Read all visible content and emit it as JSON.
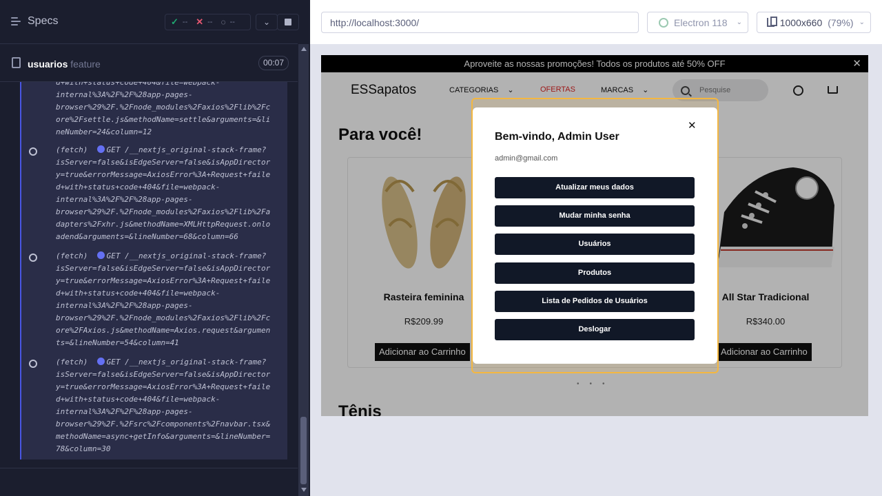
{
  "runner": {
    "specs_label": "Specs",
    "stats": {
      "passed": "--",
      "failed": "--",
      "pending": "--"
    },
    "spec": {
      "name": "usuarios",
      "tag": "feature",
      "time": "00:07"
    },
    "log_entries": [
      {
        "text": "d+with+status+code+404&file=webpack-\ninternal%3A%2F%2F%28app-pages-\nbrowser%29%2F.%2Fnode_modules%2Faxios%2Flib%2Fc\nore%2Fsettle.js&methodName=settle&arguments=&li\nneNumber=24&column=12"
      },
      {
        "prefix": "(fetch)  ",
        "method": "GET",
        "text": " /__nextjs_original-stack-frame?\nisServer=false&isEdgeServer=false&isAppDirector\ny=true&errorMessage=AxiosError%3A+Request+faile\nd+with+status+code+404&file=webpack-\ninternal%3A%2F%2F%28app-pages-\nbrowser%29%2F.%2Fnode_modules%2Faxios%2Flib%2Fa\ndapters%2Fxhr.js&methodName=XMLHttpRequest.onlo\nadend&arguments=&lineNumber=68&column=66"
      },
      {
        "prefix": "(fetch)  ",
        "method": "GET",
        "text": " /__nextjs_original-stack-frame?\nisServer=false&isEdgeServer=false&isAppDirector\ny=true&errorMessage=AxiosError%3A+Request+faile\nd+with+status+code+404&file=webpack-\ninternal%3A%2F%2F%28app-pages-\nbrowser%29%2F.%2Fnode_modules%2Faxios%2Flib%2Fc\nore%2FAxios.js&methodName=Axios.request&argumen\nts=&lineNumber=54&column=41"
      },
      {
        "prefix": "(fetch)  ",
        "method": "GET",
        "text": " /__nextjs_original-stack-frame?\nisServer=false&isEdgeServer=false&isAppDirector\ny=true&errorMessage=AxiosError%3A+Request+faile\nd+with+status+code+404&file=webpack-\ninternal%3A%2F%2F%28app-pages-\nbrowser%29%2F.%2Fsrc%2Fcomponents%2Fnavbar.tsx&\nmethodName=async+getInfo&arguments=&lineNumber=\n78&column=30"
      }
    ]
  },
  "browser": {
    "url": "http://localhost:3000/",
    "browser_name": "Electron 118",
    "viewport_size": "1000x660",
    "viewport_scale": "(79%)"
  },
  "app": {
    "promo": "Aproveite as nossas promoções! Todos os produtos até 50% OFF",
    "brand": "ESSapatos",
    "nav": {
      "categorias": "CATEGORIAS",
      "ofertas": "OFERTAS",
      "marcas": "MARCAS"
    },
    "search_placeholder": "Pesquise",
    "section_title": "Para você!",
    "section_title_2": "Tênis",
    "products": [
      {
        "name": "Rasteira feminina",
        "price": "R$209.99",
        "button": "Adicionar ao Carrinho"
      },
      {
        "name": "All Star Tradicional",
        "price": "R$340.00",
        "button": "Adicionar ao Carrinho"
      }
    ],
    "modal": {
      "title": "Bem-vindo, Admin User",
      "email": "admin@gmail.com",
      "buttons": [
        "Atualizar meus dados",
        "Mudar minha senha",
        "Usuários",
        "Produtos",
        "Lista de Pedidos de Usuários",
        "Deslogar"
      ]
    }
  },
  "colors": {
    "accent": "#4956e3",
    "highlight": "#f4b740",
    "modal_button": "#111827",
    "promo_text_red": "#e02424"
  }
}
